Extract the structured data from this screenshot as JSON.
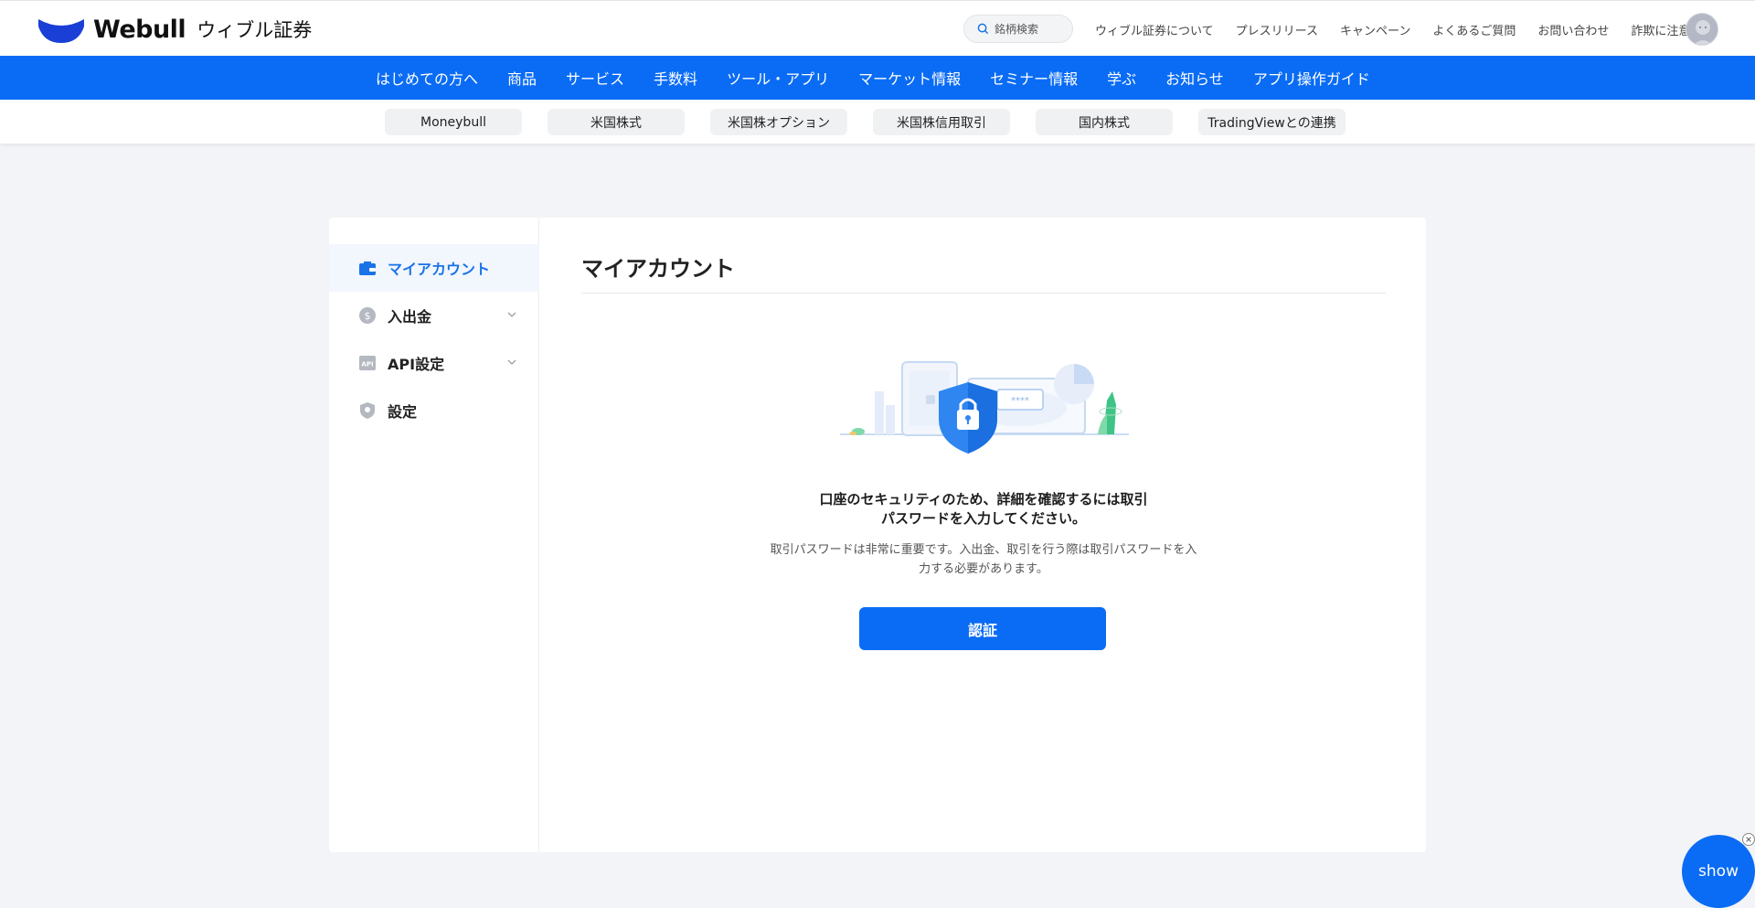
{
  "header": {
    "logo_word": "Webull",
    "logo_jp": "ウィブル証券",
    "search_placeholder": "銘柄検索",
    "links": [
      "ウィブル証券について",
      "プレスリリース",
      "キャンペーン",
      "よくあるご質問",
      "お問い合わせ",
      "詐欺に注意"
    ]
  },
  "main_nav": [
    "はじめての方へ",
    "商品",
    "サービス",
    "手数料",
    "ツール・アプリ",
    "マーケット情報",
    "セミナー情報",
    "学ぶ",
    "お知らせ",
    "アプリ操作ガイド"
  ],
  "sub_nav": [
    "Moneybull",
    "米国株式",
    "米国株オプション",
    "米国株信用取引",
    "国内株式",
    "TradingViewとの連携"
  ],
  "sidebar": {
    "items": [
      {
        "label": "マイアカウント",
        "icon": "wallet-icon",
        "active": true
      },
      {
        "label": "入出金",
        "icon": "dollar-coin-icon",
        "expandable": true
      },
      {
        "label": "API設定",
        "icon": "api-icon",
        "expandable": true
      },
      {
        "label": "設定",
        "icon": "shield-settings-icon"
      }
    ]
  },
  "content": {
    "title": "マイアカウント",
    "illustration_text": "****",
    "message_line1": "口座のセキュリティのため、詳細を確認するには取引",
    "message_line2": "パスワードを入力してください。",
    "sub_line1": "取引パスワードは非常に重要です。入出金、取引を行う際は取引パスワードを入",
    "sub_line2": "力する必要があります。",
    "verify_label": "認証"
  },
  "floating": {
    "show_label": "show"
  },
  "colors": {
    "brand_blue": "#0a6cf5",
    "active_text": "#1a73e8",
    "page_bg": "#f3f4f7"
  }
}
